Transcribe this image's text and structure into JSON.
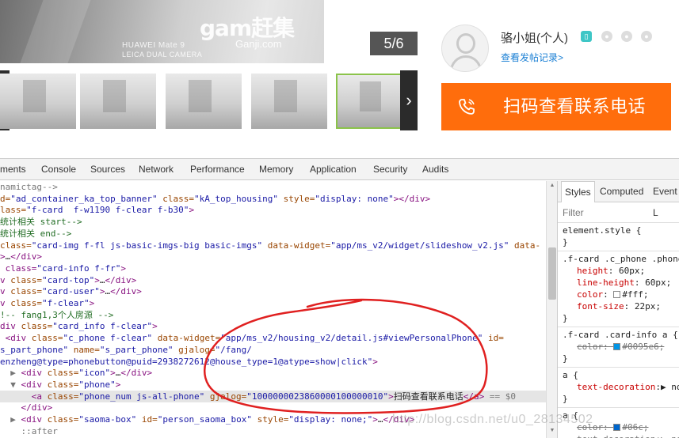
{
  "listing": {
    "photo_watermark_brand": "gam赶集",
    "photo_watermark_site": "Ganji.com",
    "camera_line1": "HUAWEI Mate 9",
    "camera_line2": "LEICA DUAL CAMERA",
    "counter": "5/6",
    "prev_arrow": "‹",
    "next_arrow": "›",
    "thumbnail_count": 5,
    "selected_thumbnail": 5
  },
  "owner": {
    "name": "骆小姐(个人)",
    "history_link": "查看发帖记录>",
    "call_button_label": "扫码查看联系电话",
    "accent_color": "#ff6d0c",
    "link_color": "#1a7fd4",
    "badge_icons": [
      "phone-verified-icon",
      "wechat-icon",
      "credit-icon",
      "user-icon"
    ]
  },
  "devtools": {
    "tabs": [
      "ments",
      "Console",
      "Sources",
      "Network",
      "Performance",
      "Memory",
      "Application",
      "Security",
      "Audits"
    ],
    "dom_lines": [
      {
        "tokens": [
          [
            "g",
            "namictag-->"
          ]
        ]
      },
      {
        "tokens": [
          [
            "a",
            "d="
          ],
          [
            "v",
            "\"ad_container_ka_top_banner\""
          ],
          [
            "a",
            " class="
          ],
          [
            "v",
            "\"kA_top_housing\""
          ],
          [
            "a",
            " style="
          ],
          [
            "v",
            "\"display: none\""
          ],
          [
            "t",
            "></div>"
          ]
        ]
      },
      {
        "tokens": [
          [
            "a",
            "lass="
          ],
          [
            "v",
            "\"f-card  f-w1190 f-clear f-b30\""
          ],
          [
            "t",
            ">"
          ]
        ]
      },
      {
        "tokens": [
          [
            "c",
            "统计相关 start-->"
          ]
        ]
      },
      {
        "tokens": [
          [
            "c",
            "统计相关 end-->"
          ]
        ]
      },
      {
        "tokens": [
          [
            "a",
            "class="
          ],
          [
            "v",
            "\"card-img f-fl js-basic-imgs-big basic-imgs\""
          ],
          [
            "a",
            " data-widget="
          ],
          [
            "v",
            "\"app/ms_v2/widget/slideshow_v2.js\""
          ],
          [
            "a",
            " data-"
          ]
        ]
      },
      {
        "tokens": [
          [
            "t",
            ">"
          ],
          [
            "tx",
            "…"
          ],
          [
            "t",
            "</div>"
          ]
        ]
      },
      {
        "tokens": [
          [
            "t",
            " class="
          ],
          [
            "v",
            "\"card-info f-fr\""
          ],
          [
            "t",
            ">"
          ]
        ]
      },
      {
        "tokens": [
          [
            "t",
            "v "
          ],
          [
            "a",
            "class="
          ],
          [
            "v",
            "\"card-top\""
          ],
          [
            "t",
            ">"
          ],
          [
            "tx",
            "…"
          ],
          [
            "t",
            "</div>"
          ]
        ]
      },
      {
        "tokens": [
          [
            "t",
            "v "
          ],
          [
            "a",
            "class="
          ],
          [
            "v",
            "\"card-user\""
          ],
          [
            "t",
            ">"
          ],
          [
            "tx",
            "…"
          ],
          [
            "t",
            "</div>"
          ]
        ]
      },
      {
        "tokens": [
          [
            "t",
            "v "
          ],
          [
            "a",
            "class="
          ],
          [
            "v",
            "\"f-clear\""
          ],
          [
            "t",
            ">"
          ]
        ]
      },
      {
        "tokens": [
          [
            "c",
            "!-- fang1,3个人房源 -->"
          ]
        ]
      },
      {
        "tokens": [
          [
            "t",
            "div "
          ],
          [
            "a",
            "class="
          ],
          [
            "v",
            "\"card_info f-clear\""
          ],
          [
            "t",
            ">"
          ]
        ]
      },
      {
        "tokens": [
          [
            "t",
            " <div "
          ],
          [
            "a",
            "class="
          ],
          [
            "v",
            "\"c_phone f-clear\""
          ],
          [
            "a",
            " data-widget="
          ],
          [
            "v",
            "\"app/ms_v2/housing_v2/detail.js#viewPersonalPhone\""
          ],
          [
            "a",
            " id="
          ]
        ]
      },
      {
        "tokens": [
          [
            "v",
            "s_part_phone\""
          ],
          [
            "a",
            " name="
          ],
          [
            "v",
            "\"s_part_phone\""
          ],
          [
            "a",
            " gjalog="
          ],
          [
            "v",
            "\"/fang/"
          ]
        ]
      },
      {
        "tokens": [
          [
            "v",
            "enzheng@type=phonebutton@puid=2938272612@house_type=1@atype=show|click\""
          ],
          [
            "t",
            ">"
          ]
        ]
      },
      {
        "tokens": [
          [
            "g",
            "  ▶ "
          ],
          [
            "t",
            "<div "
          ],
          [
            "a",
            "class="
          ],
          [
            "v",
            "\"icon\""
          ],
          [
            "t",
            ">"
          ],
          [
            "tx",
            "…"
          ],
          [
            "t",
            "</div>"
          ]
        ]
      },
      {
        "tokens": [
          [
            "g",
            "  ▼ "
          ],
          [
            "t",
            "<div "
          ],
          [
            "a",
            "class="
          ],
          [
            "v",
            "\"phone\""
          ],
          [
            "t",
            ">"
          ]
        ]
      },
      {
        "tokens": [
          [
            "t",
            "      <a "
          ],
          [
            "a",
            "class="
          ],
          [
            "v",
            "\"phone_num js-all-phone\""
          ],
          [
            "a",
            " gjalog="
          ],
          [
            "v",
            "\"1000000023860000100000010\""
          ],
          [
            "t",
            ">"
          ],
          [
            "tx",
            "扫码查看联系电话"
          ],
          [
            "t",
            "</a>"
          ],
          [
            "g",
            " == $0"
          ]
        ],
        "highlighted": true
      },
      {
        "tokens": [
          [
            "t",
            "    </div>"
          ]
        ]
      },
      {
        "tokens": [
          [
            "g",
            "  ▶ "
          ],
          [
            "t",
            "<div "
          ],
          [
            "a",
            "class="
          ],
          [
            "v",
            "\"saoma-box\""
          ],
          [
            "a",
            " id="
          ],
          [
            "v",
            "\"person_saoma_box\""
          ],
          [
            "a",
            " style="
          ],
          [
            "v",
            "\"display: none;\""
          ],
          [
            "t",
            ">"
          ],
          [
            "tx",
            "…"
          ],
          [
            "t",
            "</div>"
          ]
        ]
      },
      {
        "tokens": [
          [
            "g",
            "    ::after"
          ]
        ]
      }
    ],
    "styles": {
      "tabs": [
        "Styles",
        "Computed",
        "Event L"
      ],
      "filter_placeholder": "Filter",
      "element_style": "element.style {",
      "rule1_selector": ".f-card .c_phone .phone",
      "rule1_props": [
        [
          "height",
          "60px;"
        ],
        [
          "line-height",
          "60px;"
        ],
        [
          "color",
          "#fff;"
        ],
        [
          "font-size",
          "22px;"
        ]
      ],
      "rule2_selector": ".f-card .card-info a {",
      "rule2_prop": [
        "color",
        "#0095e6;"
      ],
      "rule3_selector": "a {",
      "rule3_prop": [
        "text-decoration",
        "no"
      ],
      "rule4_selector": "a {",
      "rule4_props": [
        [
          "color",
          "#06c;"
        ],
        [
          "text-decoration",
          "no"
        ]
      ]
    },
    "watermark": "http://blog.csdn.net/u0_28134502"
  }
}
